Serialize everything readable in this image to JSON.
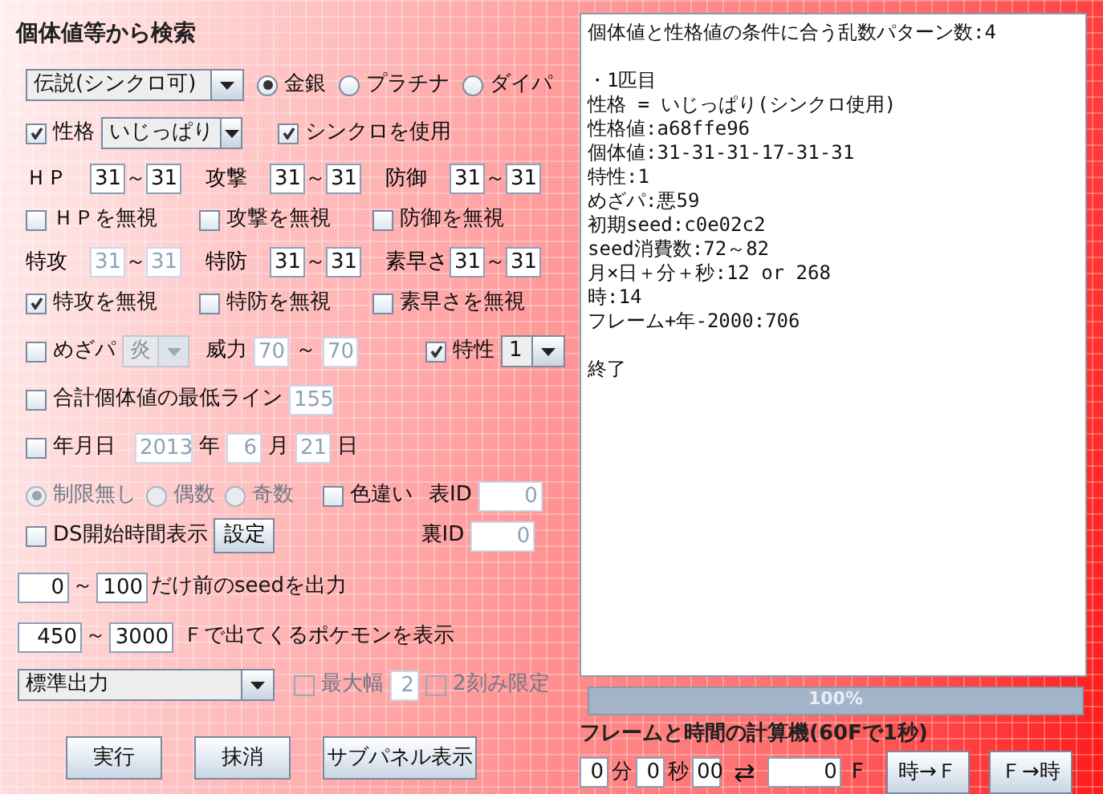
{
  "title": "個体値等から検索",
  "mode_select": {
    "value": "伝説(シンクロ可)"
  },
  "versions": [
    {
      "label": "金銀",
      "selected": true
    },
    {
      "label": "プラチナ",
      "selected": false
    },
    {
      "label": "ダイパ",
      "selected": false
    }
  ],
  "nature": {
    "checked": true,
    "label": "性格",
    "value": "いじっぱり"
  },
  "synchro": {
    "checked": true,
    "label": "シンクロを使用"
  },
  "stats": [
    {
      "label": "ＨＰ",
      "min": "31",
      "sep": "～",
      "max": "31",
      "disabled": false
    },
    {
      "label": "攻撃",
      "min": "31",
      "sep": "～",
      "max": "31",
      "disabled": false
    },
    {
      "label": "防御",
      "min": "31",
      "sep": "～",
      "max": "31",
      "disabled": false
    },
    {
      "label": "特攻",
      "min": "31",
      "sep": "～",
      "max": "31",
      "disabled": true
    },
    {
      "label": "特防",
      "min": "31",
      "sep": "～",
      "max": "31",
      "disabled": false
    },
    {
      "label": "素早さ",
      "min": "31",
      "sep": "～",
      "max": "31",
      "disabled": false
    }
  ],
  "ignores": [
    {
      "label": "ＨＰを無視",
      "checked": false
    },
    {
      "label": "攻撃を無視",
      "checked": false
    },
    {
      "label": "防御を無視",
      "checked": false
    },
    {
      "label": "特攻を無視",
      "checked": true
    },
    {
      "label": "特防を無視",
      "checked": false
    },
    {
      "label": "素早さを無視",
      "checked": false
    }
  ],
  "hidden_power": {
    "checked": false,
    "label": "めざパ",
    "value": "炎",
    "disabled": true
  },
  "power": {
    "label": "威力",
    "min": "70",
    "sep": "～",
    "max": "70",
    "disabled": true
  },
  "ability": {
    "checked": true,
    "label": "特性",
    "value": "1"
  },
  "total_min": {
    "checked": false,
    "label": "合計個体値の最低ライン",
    "value": "155",
    "disabled": true
  },
  "date": {
    "checked": false,
    "label": "年月日",
    "year": "2013",
    "year_unit": "年",
    "month": "6",
    "month_unit": "月",
    "day": "21",
    "day_unit": "日",
    "disabled": true
  },
  "parity": [
    {
      "label": "制限無し",
      "selected": true,
      "disabled": true
    },
    {
      "label": "偶数",
      "selected": false,
      "disabled": true
    },
    {
      "label": "奇数",
      "selected": false,
      "disabled": true
    }
  ],
  "shiny": {
    "checked": false,
    "label": "色違い"
  },
  "tid": {
    "label": "表ID",
    "value": "0"
  },
  "sid": {
    "label": "裏ID",
    "value": "0"
  },
  "ds_time": {
    "checked": false,
    "label": "DS開始時間表示"
  },
  "settings_button": "設定",
  "seed_range": {
    "min": "0",
    "sep": "～",
    "max": "100",
    "label": "だけ前のseedを出力"
  },
  "frame_range": {
    "min": "450",
    "sep": "～",
    "max": "3000",
    "label": "Ｆで出てくるポケモンを表示"
  },
  "output_select": {
    "value": "標準出力"
  },
  "max_width": {
    "checked": false,
    "label": "最大幅",
    "value": "2",
    "disabled": true
  },
  "step2": {
    "checked": false,
    "label": "2刻み限定",
    "disabled": true
  },
  "buttons": [
    "実行",
    "抹消",
    "サブパネル表示"
  ],
  "result_paragraphs": [
    [
      "個体値と性格値の条件に合う乱数パターン数:4"
    ],
    [
      "・1匹目",
      "性格 = いじっぱり(シンクロ使用)",
      "性格値:a68ffe96",
      "個体値:31-31-31-17-31-31",
      "特性:1",
      "めざパ:悪59",
      "初期seed:c0e02c2",
      "seed消費数:72～82",
      "月×日＋分＋秒:12 or 268",
      "時:14",
      "フレーム+年-2000:706"
    ],
    [
      "終了"
    ]
  ],
  "progress": {
    "level": 1,
    "label": "100%"
  },
  "calc": {
    "title": "フレームと時間の計算機(60Fで1秒)",
    "minutes": "0",
    "minutes_unit": "分",
    "seconds": "0",
    "seconds_unit": "秒",
    "fraction": "00",
    "swap": "⇄",
    "frames": "0",
    "frames_unit": "F",
    "buttons": [
      "時→Ｆ",
      "Ｆ→時"
    ]
  }
}
